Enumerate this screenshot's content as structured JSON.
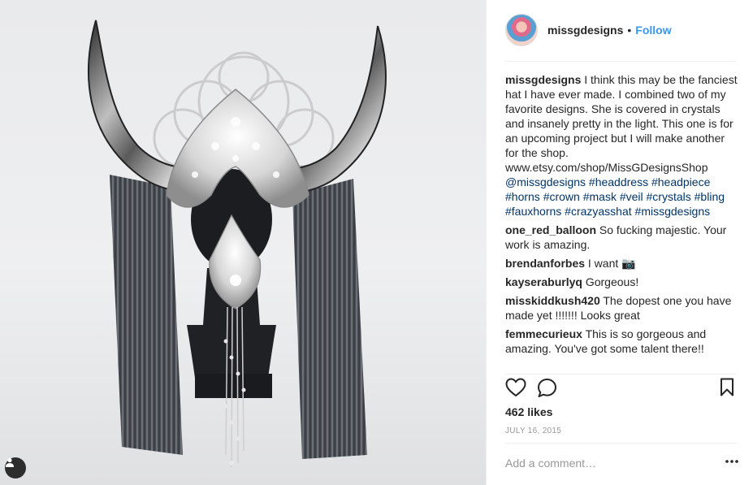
{
  "post": {
    "username": "missgdesigns",
    "separator": "•",
    "follow_label": "Follow"
  },
  "caption": {
    "username": "missgdesigns",
    "text": "I think this may be the fanciest hat I have ever made. I combined two of my favorite designs. She is covered in crystals and insanely pretty in the light. This one is for an upcoming project but I will make another for the shop. www.etsy.com/shop/MissGDesignsShop",
    "hashtags": "@missgdesigns #headdress #headpiece #horns #crown #mask #veil #crystals #bling #fauxhorns #crazyasshat #missgdesigns"
  },
  "comments": [
    {
      "user": "one_red_balloon",
      "text": "So fucking majestic. Your work is amazing."
    },
    {
      "user": "brendanforbes",
      "text": "I want 📷"
    },
    {
      "user": "kayseraburlyq",
      "text": "Gorgeous!"
    },
    {
      "user": "misskiddkush420",
      "text": "The dopest one you have made yet !!!!!!! Looks great"
    },
    {
      "user": "femmecurieux",
      "text": "This is so gorgeous and amazing. You've got some talent there!!"
    }
  ],
  "stats": {
    "likes": "462 likes",
    "date": "JULY 16, 2015"
  },
  "add_comment": {
    "placeholder": "Add a comment…"
  },
  "icons": {
    "like": "heart-outline-icon",
    "comment": "speech-bubble-icon",
    "save": "bookmark-icon",
    "more": "ellipsis-icon",
    "tagged": "person-tag-icon"
  },
  "colors": {
    "follow": "#3897f0",
    "hashtag": "#003569",
    "muted": "#999999",
    "text": "#262626"
  }
}
